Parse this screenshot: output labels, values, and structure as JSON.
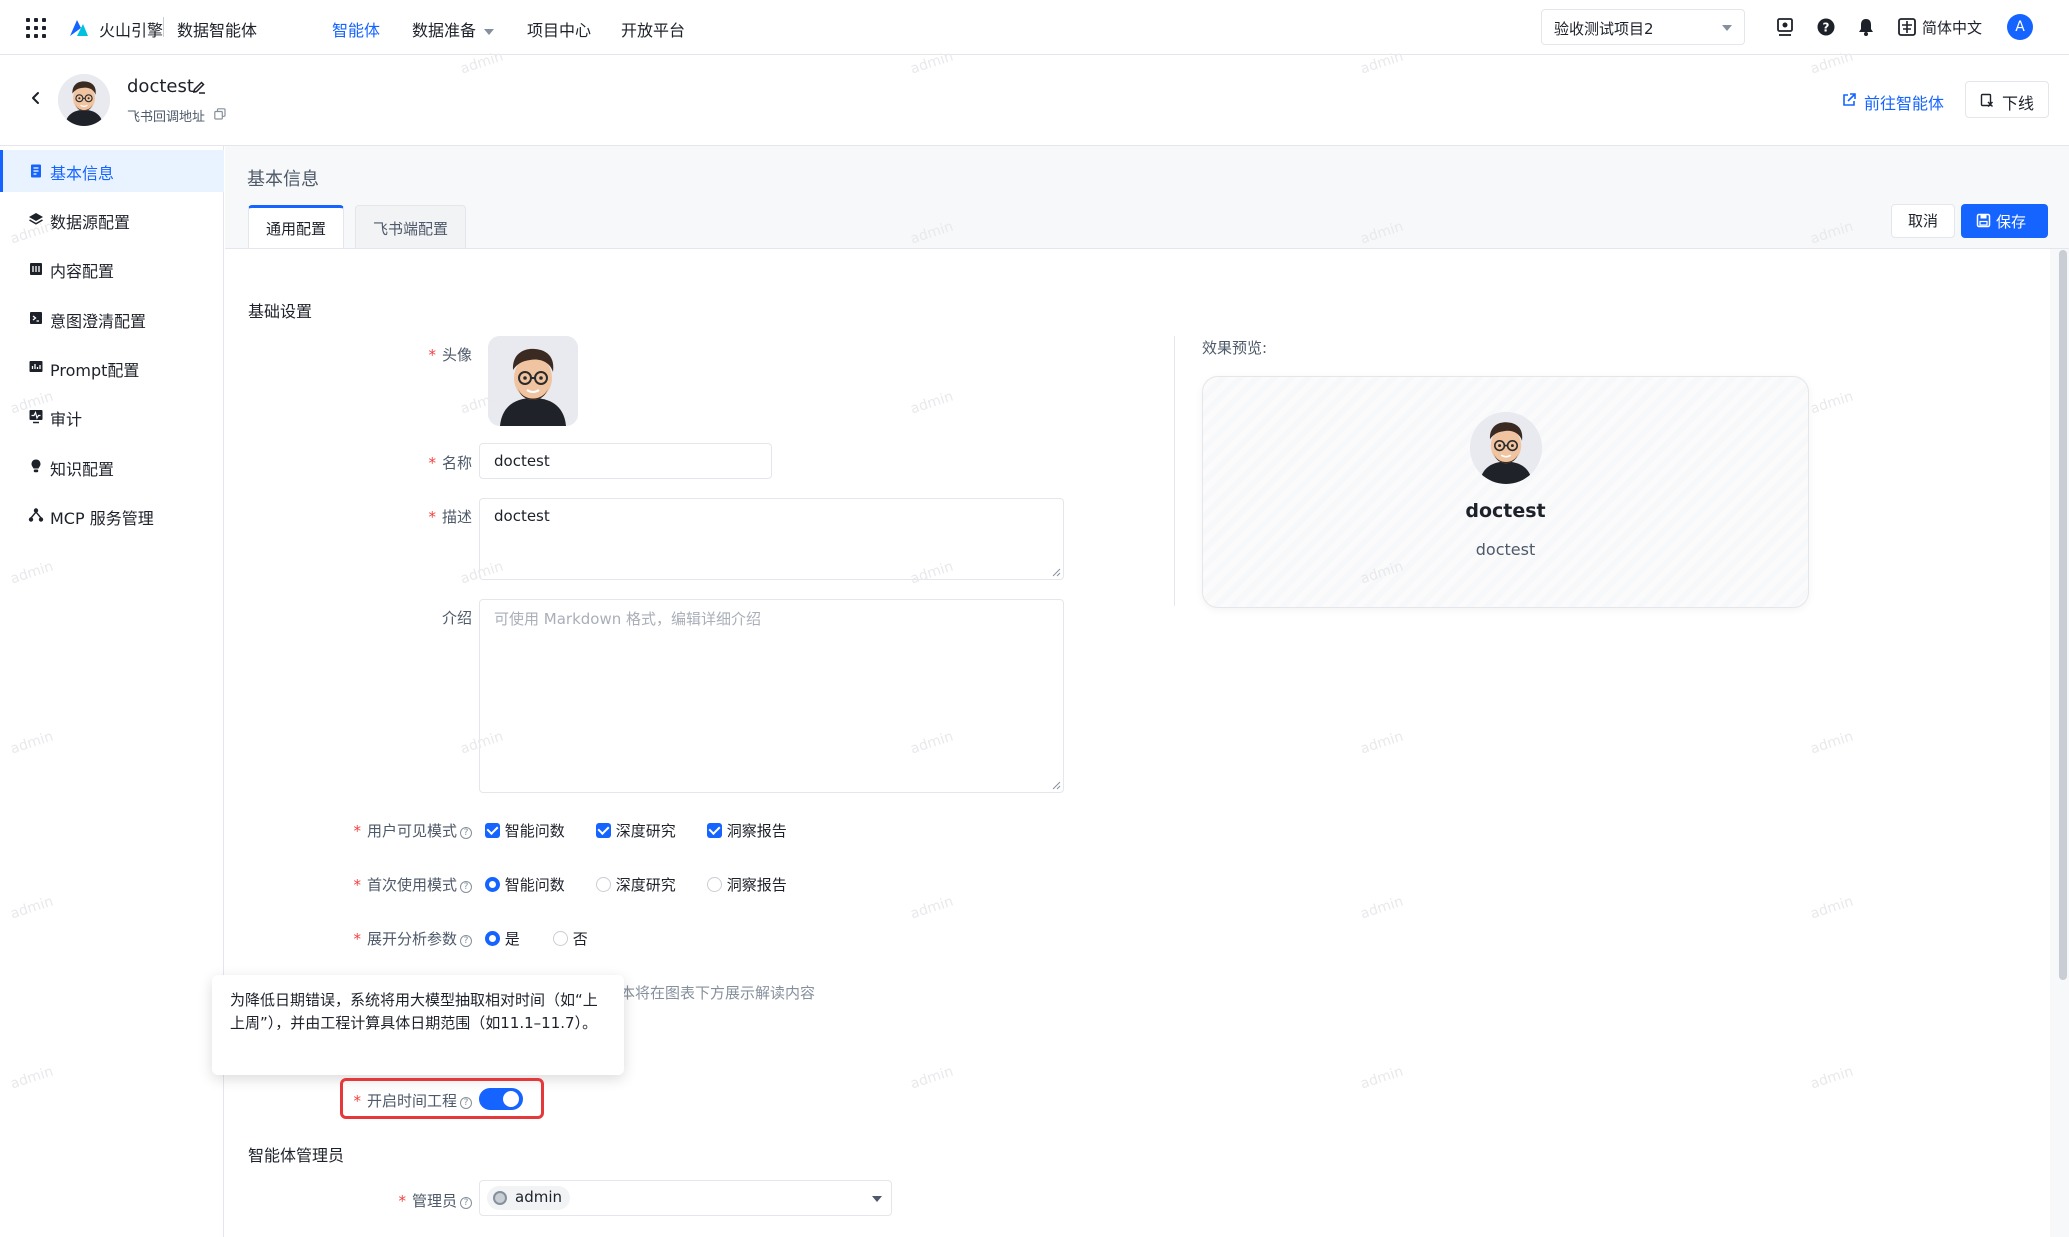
{
  "topnav": {
    "brand": "火山引擎",
    "product": "数据智能体",
    "items": [
      {
        "label": "智能体",
        "active": true
      },
      {
        "label": "数据准备",
        "dropdown": true
      },
      {
        "label": "项目中心"
      },
      {
        "label": "开放平台"
      }
    ],
    "project_select": "验收测试项目2",
    "language": "简体中文",
    "user_initial": "A"
  },
  "header": {
    "agent_name": "doctest",
    "subtitle": "飞书回调地址",
    "goto_link": "前往智能体",
    "offline_button": "下线"
  },
  "sidebar": {
    "items": [
      {
        "label": "基本信息",
        "icon": "doc-icon",
        "active": true
      },
      {
        "label": "数据源配置",
        "icon": "layers-icon"
      },
      {
        "label": "内容配置",
        "icon": "book-icon"
      },
      {
        "label": "意图澄清配置",
        "icon": "terminal-icon"
      },
      {
        "label": "Prompt配置",
        "icon": "chart-icon"
      },
      {
        "label": "审计",
        "icon": "monitor-icon"
      },
      {
        "label": "知识配置",
        "icon": "bulb-icon"
      },
      {
        "label": "MCP 服务管理",
        "icon": "network-icon"
      }
    ]
  },
  "page": {
    "section_title": "基本信息",
    "tabs": [
      {
        "label": "通用配置",
        "active": true
      },
      {
        "label": "飞书端配置"
      }
    ],
    "cancel_label": "取消",
    "save_label": "保存"
  },
  "form": {
    "group_basic": "基础设置",
    "avatar_label": "头像",
    "name_label": "名称",
    "name_value": "doctest",
    "desc_label": "描述",
    "desc_value": "doctest",
    "intro_label": "介绍",
    "intro_placeholder": "可使用 Markdown 格式，编辑详细介绍",
    "visible_mode_label": "用户可见模式",
    "visible_modes": [
      {
        "label": "智能问数",
        "checked": true
      },
      {
        "label": "深度研究",
        "checked": true
      },
      {
        "label": "洞察报告",
        "checked": true
      }
    ],
    "first_mode_label": "首次使用模式",
    "first_modes": [
      {
        "label": "智能问数",
        "selected": true
      },
      {
        "label": "深度研究",
        "selected": false
      },
      {
        "label": "洞察报告",
        "selected": false
      }
    ],
    "expand_label": "展开分析参数",
    "expand_options": [
      {
        "label": "是",
        "selected": true
      },
      {
        "label": "否",
        "selected": false
      }
    ],
    "partial_hint": "本将在图表下方展示解读内容",
    "time_eng_label": "开启时间工程",
    "time_eng_enabled": true,
    "group_admin": "智能体管理员",
    "admin_label": "管理员",
    "admin_value": "admin"
  },
  "preview": {
    "label": "效果预览:",
    "name": "doctest",
    "desc": "doctest"
  },
  "tooltip": {
    "text": "为降低日期错误，系统将用大模型抽取相对时间（如“上上周”），并由工程计算具体日期范围（如11.1–11.7）。"
  },
  "watermark": "admin",
  "colors": {
    "accent": "#1664ff",
    "highlight": "#e5383b"
  }
}
